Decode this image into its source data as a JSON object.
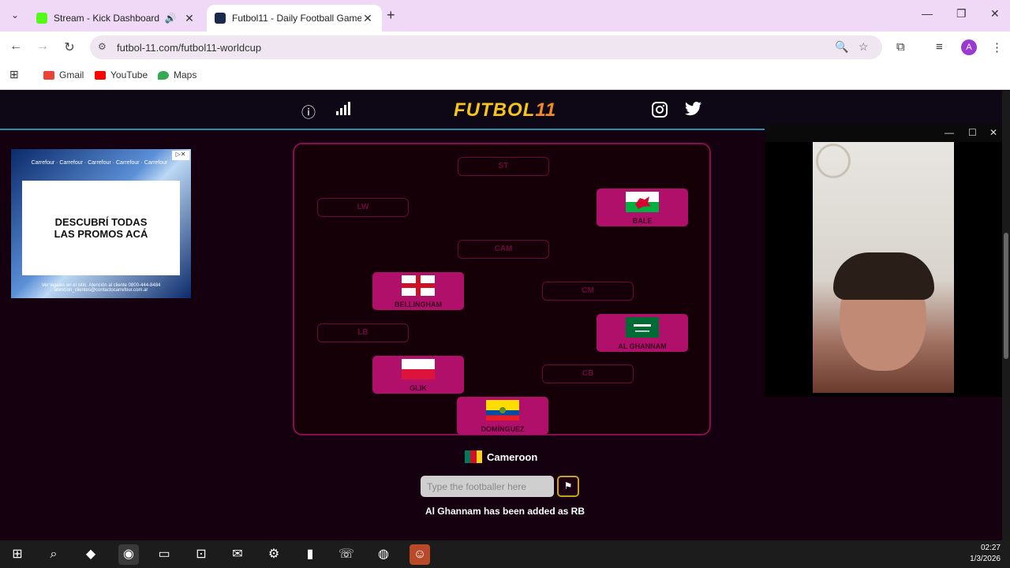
{
  "browser": {
    "tabs": [
      {
        "title": "Stream - Kick Dashboard",
        "active": false
      },
      {
        "title": "Futbol11 - Daily Football Game",
        "active": true
      }
    ],
    "url": "futbol-11.com/futbol11-worldcup",
    "bookmarks": [
      "Gmail",
      "YouTube",
      "Maps"
    ],
    "profile_initial": "A"
  },
  "site": {
    "logo_main": "FUTBOL",
    "logo_accent": "11"
  },
  "ad": {
    "strip": "Carrefour · Carrefour · Carrefour · Carrefour · Carrefour",
    "headline": "DESCUBRÍ TODAS\nLAS PROMOS ACÁ",
    "footer": "Ver legales en el sitio. Atención al cliente 0800-444-8484 atencion_clientes@contactocarrefour.com.ar"
  },
  "pitch": {
    "empty_slots": {
      "st": "ST",
      "lw": "LW",
      "cam": "CAM",
      "cm": "CM",
      "lb": "LB",
      "cb": "CB"
    },
    "players": {
      "rw": {
        "name": "Bale",
        "flag": "wales"
      },
      "lcm": {
        "name": "Bellingham",
        "flag": "england"
      },
      "rb": {
        "name": "Al Ghannam",
        "flag": "saudi-arabia"
      },
      "lcb": {
        "name": "Glik",
        "flag": "poland"
      },
      "gk": {
        "name": "Domínguez",
        "flag": "ecuador"
      }
    }
  },
  "game": {
    "country": "Cameroon",
    "input_placeholder": "Type the footballer here",
    "status": "Al Ghannam has been added as RB"
  },
  "taskbar": {
    "time": "02:27",
    "date": "1/3/2026"
  }
}
